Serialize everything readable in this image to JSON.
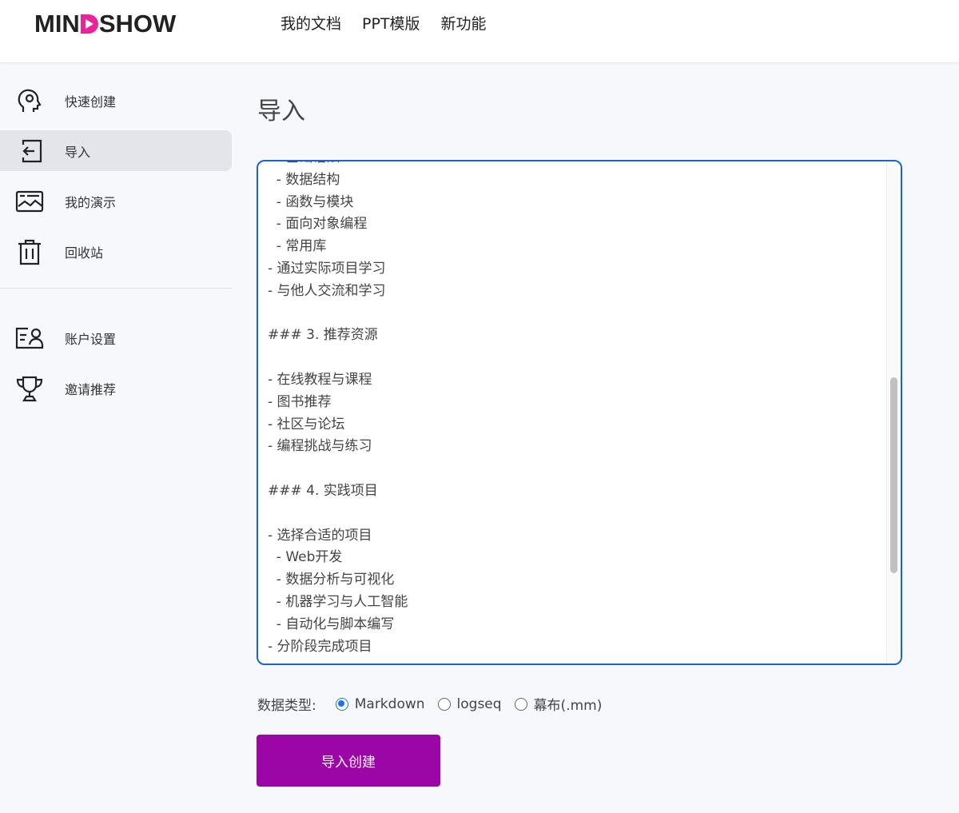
{
  "header": {
    "logo": "MINDSHOW",
    "nav": [
      "我的文档",
      "PPT模版",
      "新功能"
    ]
  },
  "sidebar": {
    "items": [
      {
        "label": "快速创建",
        "icon": "brain-head-icon"
      },
      {
        "label": "导入",
        "icon": "import-icon",
        "active": true
      },
      {
        "label": "我的演示",
        "icon": "presentation-icon"
      },
      {
        "label": "回收站",
        "icon": "trash-icon"
      },
      {
        "label": "账户设置",
        "icon": "account-card-icon"
      },
      {
        "label": "邀请推荐",
        "icon": "trophy-icon"
      }
    ]
  },
  "main": {
    "title": "导入",
    "textarea_value": "  - 基础语法\n  - 数据结构\n  - 函数与模块\n  - 面向对象编程\n  - 常用库\n- 通过实际项目学习\n- 与他人交流和学习\n\n### 3. 推荐资源\n\n- 在线教程与课程\n- 图书推荐\n- 社区与论坛\n- 编程挑战与练习\n\n### 4. 实践项目\n\n- 选择合适的项目\n  - Web开发\n  - 数据分析与可视化\n  - 机器学习与人工智能\n  - 自动化与脚本编写\n- 分阶段完成项目",
    "data_type_label": "数据类型:",
    "data_types": [
      {
        "label": "Markdown",
        "selected": true
      },
      {
        "label": "logseq",
        "selected": false
      },
      {
        "label": "幕布(.mm)",
        "selected": false
      }
    ],
    "submit_label": "导入创建"
  },
  "colors": {
    "accent": "#9c05a6",
    "focus": "#1565d8",
    "logo_d": "#e8239b"
  }
}
